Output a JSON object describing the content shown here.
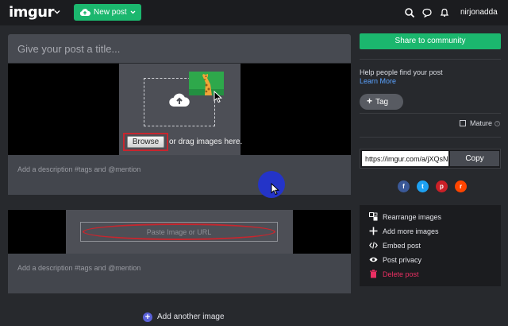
{
  "topbar": {
    "logo": "imgur",
    "new_post_label": "New post",
    "username": "nirjonadda"
  },
  "post": {
    "title_placeholder": "Give your post a title...",
    "images": [
      {
        "browse_label": "Browse",
        "drag_text": "or drag images here.",
        "description_placeholder": "Add a description #tags and @mention"
      },
      {
        "url_placeholder": "Paste Image or URL",
        "description_placeholder": "Add a description #tags and @mention"
      }
    ],
    "add_another_label": "Add another image"
  },
  "sidebar": {
    "share_label": "Share to community",
    "help_text": "Help people find your post",
    "learn_more": "Learn More",
    "tag_label": "Tag",
    "mature_label": "Mature",
    "mature_checked": false,
    "link_url": "https://imgur.com/a/jXQsN",
    "copy_label": "Copy",
    "social": [
      {
        "icon": "facebook-icon",
        "glyph": "f",
        "color": "#3b5998"
      },
      {
        "icon": "twitter-icon",
        "glyph": "t",
        "color": "#1da1f2"
      },
      {
        "icon": "pinterest-icon",
        "glyph": "p",
        "color": "#cb2027"
      },
      {
        "icon": "reddit-icon",
        "glyph": "r",
        "color": "#ff4500"
      }
    ],
    "actions": [
      {
        "icon": "rearrange-icon",
        "label": "Rearrange images"
      },
      {
        "icon": "plus-icon",
        "label": "Add more images"
      },
      {
        "icon": "code-icon",
        "label": "Embed post"
      },
      {
        "icon": "eye-icon",
        "label": "Post privacy"
      },
      {
        "icon": "trash-icon",
        "label": "Delete post"
      }
    ]
  },
  "colors": {
    "accent_green": "#1bb76e",
    "highlight_red": "#c7262e",
    "delete_pink": "#ec2f63",
    "link_blue": "#5aa2ff",
    "cursor_circle": "#2434c8"
  }
}
